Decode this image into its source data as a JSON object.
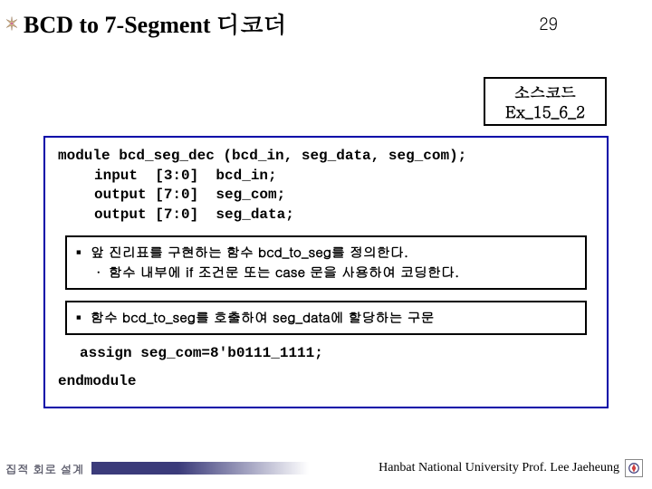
{
  "header": {
    "title": "BCD to 7-Segment 디코더",
    "page_number": "29"
  },
  "source_box": {
    "line1": "소스코드",
    "line2": "Ex_15_6_2"
  },
  "code": {
    "l1": "module bcd_seg_dec (bcd_in, seg_data, seg_com);",
    "l2": "input  [3:0]  bcd_in;",
    "l3": "output [7:0]  seg_com;",
    "l4": "output [7:0]  seg_data;"
  },
  "note1": {
    "bullet_symbol": "▪",
    "line1": "앞 진리표를 구현하는 함수 bcd_to_seg를 정의한다.",
    "sub_symbol": "·",
    "line2": "함수 내부에 if 조건문 또는 case 문을 사용하여 코딩한다."
  },
  "note2": {
    "bullet_symbol": "▪",
    "line1": "함수 bcd_to_seg를 호출하여 seg_data에 할당하는 구문"
  },
  "assign": "assign seg_com=8'b0111_1111;",
  "endmodule": "endmodule",
  "footer": {
    "left": "집적 회로 설계",
    "right": "Hanbat National University Prof. Lee Jaeheung"
  }
}
